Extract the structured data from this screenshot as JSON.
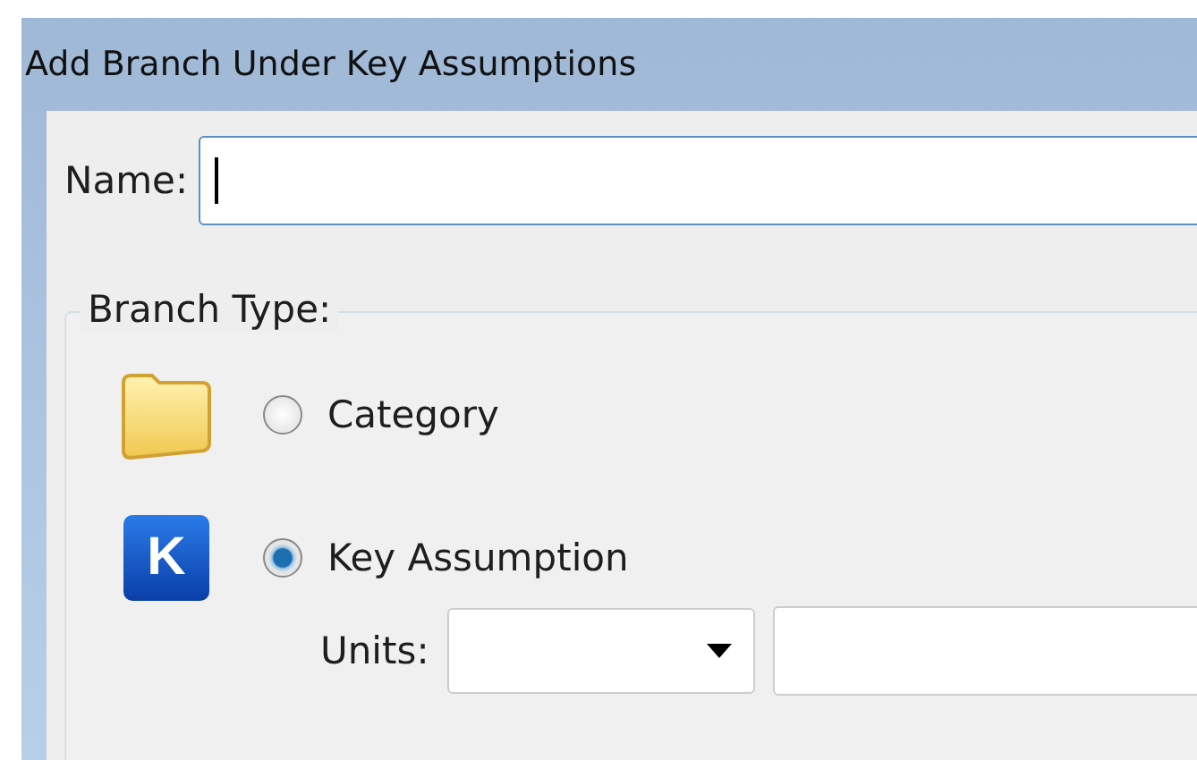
{
  "window": {
    "title": "Add Branch Under Key Assumptions"
  },
  "name_field": {
    "label": "Name:",
    "focused": true
  },
  "branch_type": {
    "title": "Branch Type:",
    "options": [
      {
        "kind": "folder",
        "label": "Category",
        "selected": false
      },
      {
        "kind": "letter",
        "icon_letter": "K",
        "label": "Key Assumption",
        "selected": true
      }
    ]
  },
  "units": {
    "label": "Units:"
  }
}
